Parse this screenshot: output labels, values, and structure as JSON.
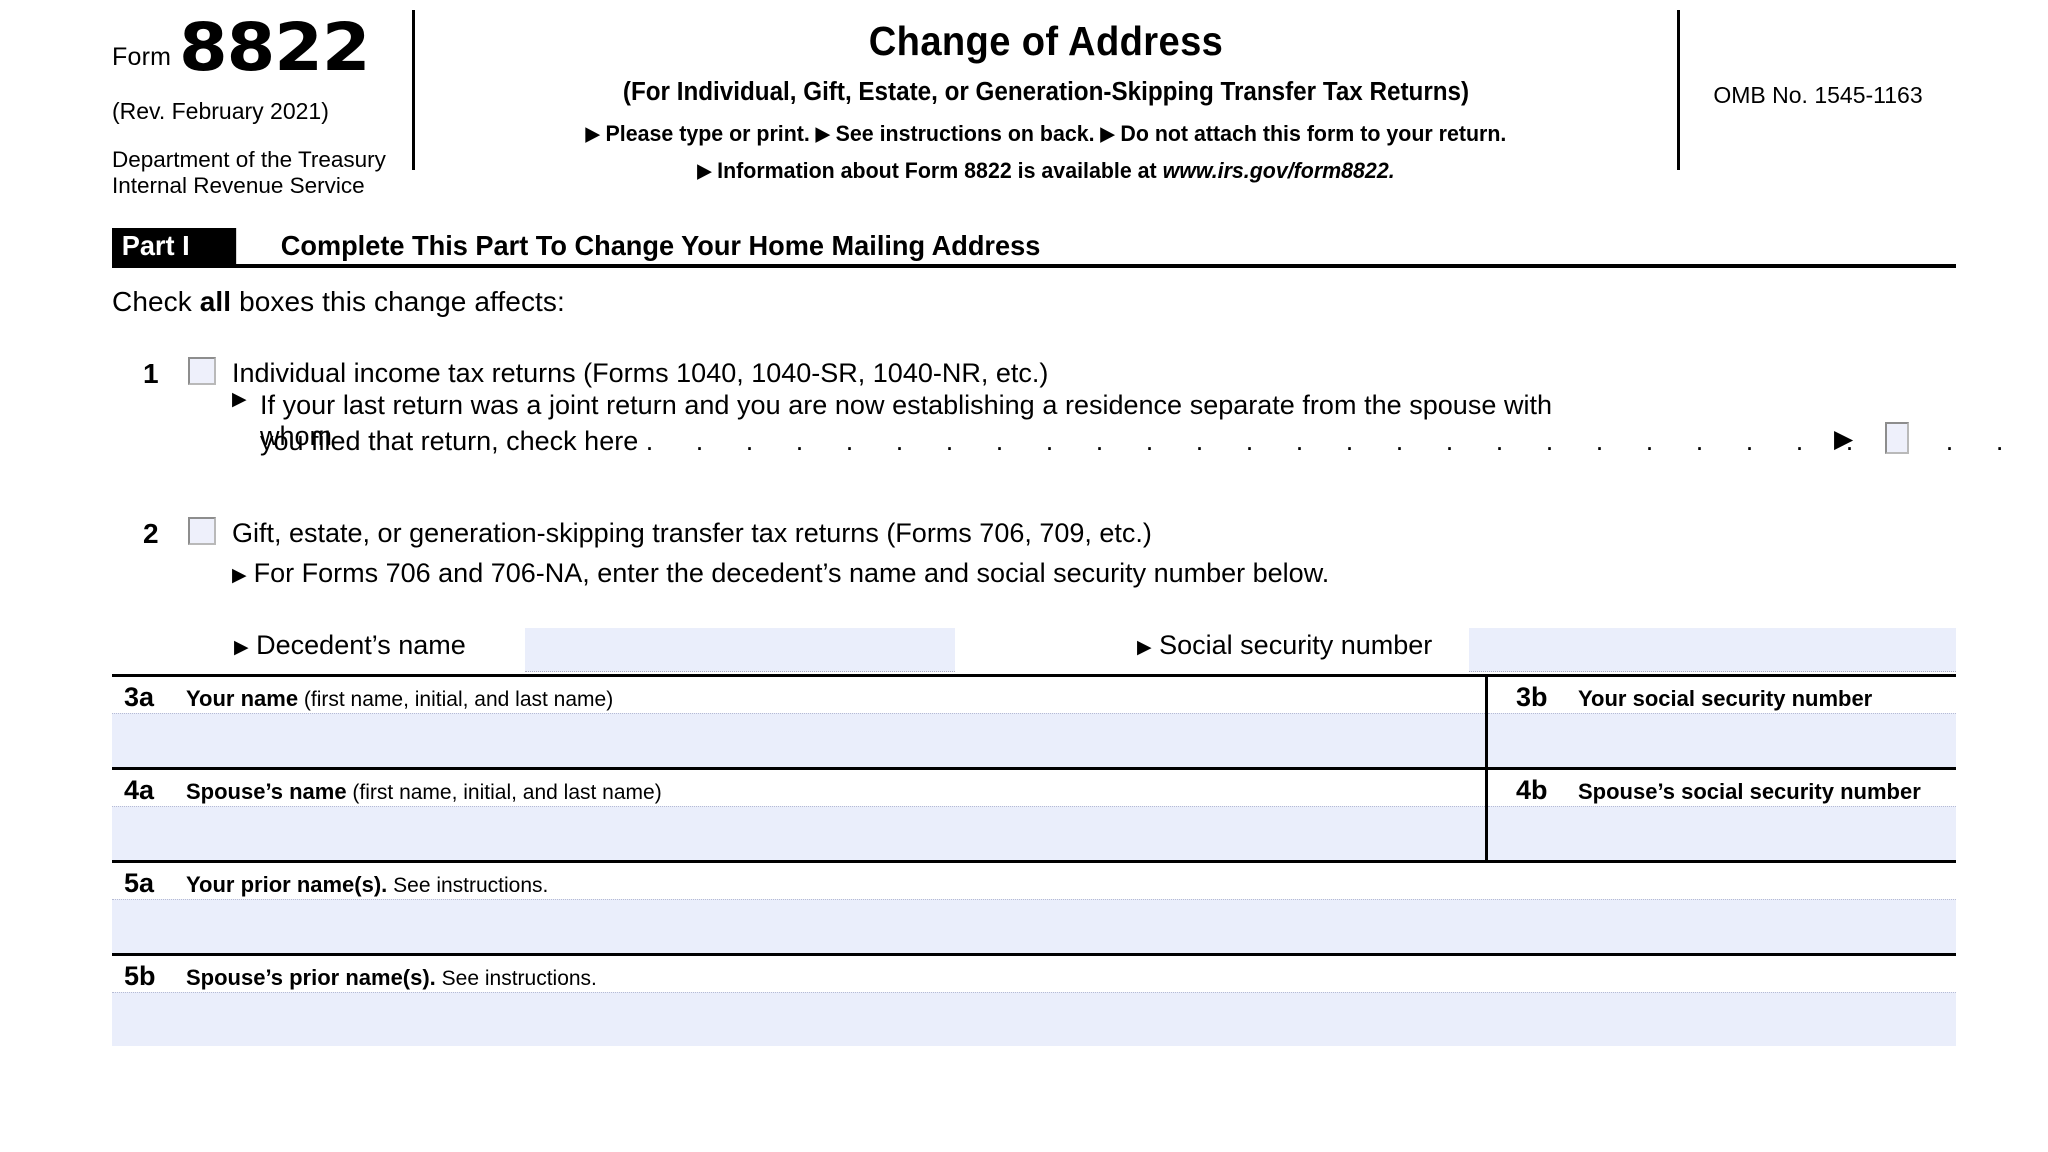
{
  "header": {
    "form_word": "Form",
    "form_number": "8822",
    "revision": "(Rev. February 2021)",
    "department_line1": "Department of the Treasury",
    "department_line2": "Internal Revenue Service",
    "title": "Change of Address",
    "subtitle": "(For Individual, Gift, Estate, or Generation-Skipping Transfer Tax Returns)",
    "note_line1_a": "Please type or print.",
    "note_line1_b": "See instructions on back.",
    "note_line1_c": "Do not attach this form to your return.",
    "note_line2_prefix": "Information about Form 8822 is available at ",
    "note_line2_url": "www.irs.gov/form8822.",
    "omb": "OMB No. 1545-1163",
    "triangle_icon": "▶"
  },
  "part": {
    "badge": "Part I",
    "title": "Complete This Part To Change Your Home Mailing Address"
  },
  "instruction": {
    "prefix": "Check ",
    "bold": "all",
    "suffix": " boxes this change affects:"
  },
  "lines": {
    "line1": {
      "number": "1",
      "text": "Individual income tax returns (Forms 1040, 1040-SR, 1040-NR, etc.)",
      "sub_line1": "If your last return was a joint return and you are now establishing a residence separate from the spouse with whom",
      "sub_line2": "you filed that return, check here",
      "leader_dots": ". . . . . . . . . . . . . . . . . . . . . . . . . . . . . . ."
    },
    "line2": {
      "number": "2",
      "text": "Gift, estate, or generation-skipping transfer tax returns (Forms 706, 709, etc.)",
      "sub_line1": "For Forms 706 and 706-NA, enter the decedent’s name and social security number below."
    }
  },
  "decedent": {
    "name_label": "Decedent’s name",
    "name_value": "",
    "ssn_label": "Social security number",
    "ssn_value": ""
  },
  "table": {
    "rows": [
      {
        "left": {
          "number": "3a",
          "label_strong": "Your name",
          "label_regular": " (first name, initial, and last name)",
          "value": ""
        },
        "right": {
          "number": "3b",
          "label_strong": "Your social security number",
          "label_regular": "",
          "value": ""
        }
      },
      {
        "left": {
          "number": "4a",
          "label_strong": "Spouse’s name",
          "label_regular": " (first name, initial, and last name)",
          "value": ""
        },
        "right": {
          "number": "4b",
          "label_strong": "Spouse’s social security number",
          "label_regular": "",
          "value": ""
        }
      }
    ],
    "full_rows": [
      {
        "number": "5a",
        "label_strong": "Your prior name(s).",
        "label_regular": " See instructions.",
        "value": ""
      },
      {
        "number": "5b",
        "label_strong": "Spouse’s prior name(s).",
        "label_regular": " See instructions.",
        "value": ""
      }
    ]
  },
  "colors": {
    "field_fill": "#eaeefb",
    "checkbox_fill": "#eef0fb",
    "rule": "#000000"
  }
}
